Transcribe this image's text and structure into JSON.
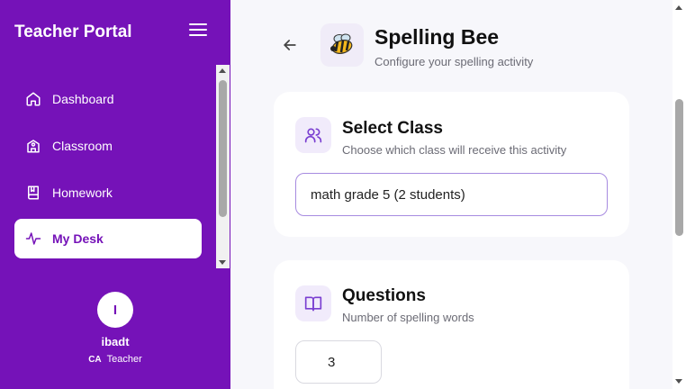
{
  "sidebar": {
    "brand": "Teacher Portal",
    "items": [
      {
        "label": "Dashboard",
        "icon": "home-icon"
      },
      {
        "label": "Classroom",
        "icon": "school-icon"
      },
      {
        "label": "Homework",
        "icon": "book-icon"
      },
      {
        "label": "My Desk",
        "icon": "activity-icon",
        "active": true
      }
    ],
    "profile": {
      "initial": "I",
      "name": "ibadt",
      "region": "CA",
      "role": "Teacher"
    }
  },
  "header": {
    "title": "Spelling Bee",
    "subtitle": "Configure your spelling activity",
    "icon": "bee-icon"
  },
  "select_class": {
    "title": "Select Class",
    "subtitle": "Choose which class will receive this activity",
    "value": "math grade 5 (2 students)"
  },
  "questions": {
    "title": "Questions",
    "subtitle": "Number of spelling words",
    "value": "3"
  },
  "colors": {
    "brand": "#7512b8",
    "accent_border": "#a78be0"
  }
}
